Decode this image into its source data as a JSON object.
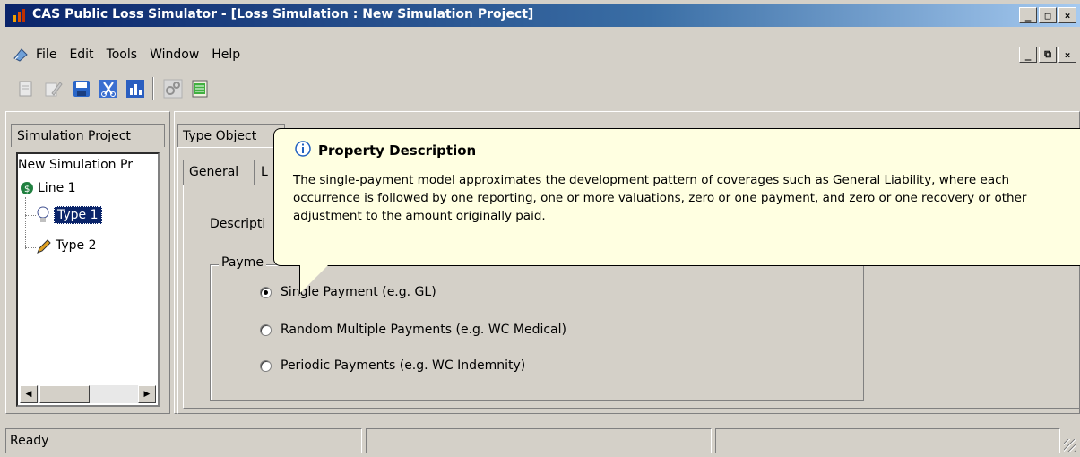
{
  "window": {
    "title": "CAS Public Loss Simulator - [Loss Simulation : New Simulation Project]",
    "minimize": "_",
    "maximize": "□",
    "close": "×",
    "restore": "⧉"
  },
  "menu": {
    "items": [
      "File",
      "Edit",
      "Tools",
      "Window",
      "Help"
    ]
  },
  "toolbar": {
    "icons": [
      "new-doc-icon",
      "edit-icon",
      "save-icon",
      "cut-icon",
      "chart-icon",
      "gears-icon",
      "export-icon"
    ]
  },
  "left_panel": {
    "tab_label": "Simulation Project",
    "tree": {
      "root": "New Simulation Pr",
      "line": "Line 1",
      "type1": "Type 1",
      "type2": "Type 2"
    },
    "scroll_left": "◀",
    "scroll_right": "▶"
  },
  "right_panel": {
    "outer_tab": "Type Object",
    "inner_tabs": [
      "General",
      "L"
    ],
    "description_label": "Descripti",
    "group_label": "Payme",
    "radios": [
      {
        "label": "Single Payment (e.g. GL)",
        "selected": true
      },
      {
        "label": "Random Multiple Payments (e.g. WC Medical)",
        "selected": false
      },
      {
        "label": "Periodic Payments (e.g. WC Indemnity)",
        "selected": false
      }
    ]
  },
  "tooltip": {
    "title": "Property Description",
    "text": "The single-payment model approximates the development pattern of coverages such as General Liability, where each occurrence is followed by one reporting, one or more valuations, zero or one payment, and zero or one recovery or other adjustment to the amount originally paid.",
    "bg_color": "#ffffe1"
  },
  "status": {
    "text": "Ready",
    "panel2": "",
    "panel3": ""
  },
  "colors": {
    "title_bar": "#0a246a",
    "selection": "#0a246a",
    "face": "#d4d0c8"
  }
}
